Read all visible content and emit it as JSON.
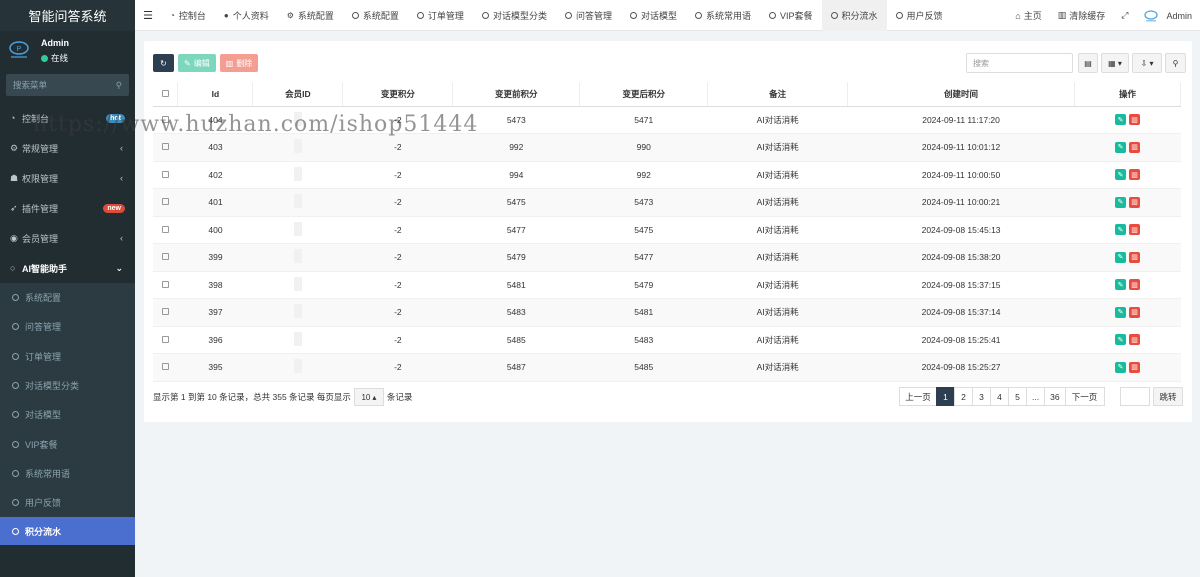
{
  "app": {
    "title": "智能问答系统"
  },
  "user": {
    "name": "Admin",
    "status": "在线"
  },
  "sidebar": {
    "search_placeholder": "搜索菜单",
    "items": [
      {
        "label": "控制台",
        "icon": "dashboard-icon",
        "badge": "hot"
      },
      {
        "label": "常规管理",
        "icon": "cogs-icon"
      },
      {
        "label": "权限管理",
        "icon": "group-icon"
      },
      {
        "label": "插件管理",
        "icon": "rocket-icon",
        "badge": "new"
      },
      {
        "label": "会员管理",
        "icon": "user-circle-icon"
      },
      {
        "label": "AI智能助手",
        "icon": "circle-icon"
      }
    ],
    "sub_items": [
      "系统配置",
      "问答管理",
      "订单管理",
      "对话模型分类",
      "对话模型",
      "VIP套餐",
      "系统常用语",
      "用户反馈",
      "积分流水"
    ]
  },
  "topnav": {
    "tabs": [
      "控制台",
      "个人资料",
      "系统配置",
      "系统配置",
      "订单管理",
      "对话模型分类",
      "问答管理",
      "对话模型",
      "系统常用语",
      "VIP套餐",
      "积分流水",
      "用户反馈"
    ],
    "home": "主页",
    "clear_cache": "清除缓存",
    "admin": "Admin"
  },
  "toolbar": {
    "edit_label": "编辑",
    "delete_label": "删除",
    "search_placeholder": "搜索"
  },
  "table": {
    "headers": [
      "Id",
      "会员ID",
      "变更积分",
      "变更前积分",
      "变更后积分",
      "备注",
      "创建时间",
      "操作"
    ],
    "rows": [
      {
        "id": "404",
        "change": "-2",
        "before": "5473",
        "after": "5471",
        "remark": "AI对话消耗",
        "time": "2024-09-11 11:17:20"
      },
      {
        "id": "403",
        "change": "-2",
        "before": "992",
        "after": "990",
        "remark": "AI对话消耗",
        "time": "2024-09-11 10:01:12"
      },
      {
        "id": "402",
        "change": "-2",
        "before": "994",
        "after": "992",
        "remark": "AI对话消耗",
        "time": "2024-09-11 10:00:50"
      },
      {
        "id": "401",
        "change": "-2",
        "before": "5475",
        "after": "5473",
        "remark": "AI对话消耗",
        "time": "2024-09-11 10:00:21"
      },
      {
        "id": "400",
        "change": "-2",
        "before": "5477",
        "after": "5475",
        "remark": "AI对话消耗",
        "time": "2024-09-08 15:45:13"
      },
      {
        "id": "399",
        "change": "-2",
        "before": "5479",
        "after": "5477",
        "remark": "AI对话消耗",
        "time": "2024-09-08 15:38:20"
      },
      {
        "id": "398",
        "change": "-2",
        "before": "5481",
        "after": "5479",
        "remark": "AI对话消耗",
        "time": "2024-09-08 15:37:15"
      },
      {
        "id": "397",
        "change": "-2",
        "before": "5483",
        "after": "5481",
        "remark": "AI对话消耗",
        "time": "2024-09-08 15:37:14"
      },
      {
        "id": "396",
        "change": "-2",
        "before": "5485",
        "after": "5483",
        "remark": "AI对话消耗",
        "time": "2024-09-08 15:25:41"
      },
      {
        "id": "395",
        "change": "-2",
        "before": "5487",
        "after": "5485",
        "remark": "AI对话消耗",
        "time": "2024-09-08 15:25:27"
      }
    ]
  },
  "pagination": {
    "info_prefix": "显示第 1 到第 10 条记录，总共 355 条记录 每页显示",
    "page_size": "10",
    "info_suffix": "条记录",
    "prev": "上一页",
    "pages": [
      "1",
      "2",
      "3",
      "4",
      "5",
      "...",
      "36"
    ],
    "next": "下一页",
    "jump": "跳转"
  },
  "watermark": "https://www.huzhan.com/ishop51444",
  "colors": {
    "sidebar_bg": "#222d32",
    "active": "#4a6fce",
    "edit": "#18bc9c",
    "delete": "#e74c3c"
  }
}
